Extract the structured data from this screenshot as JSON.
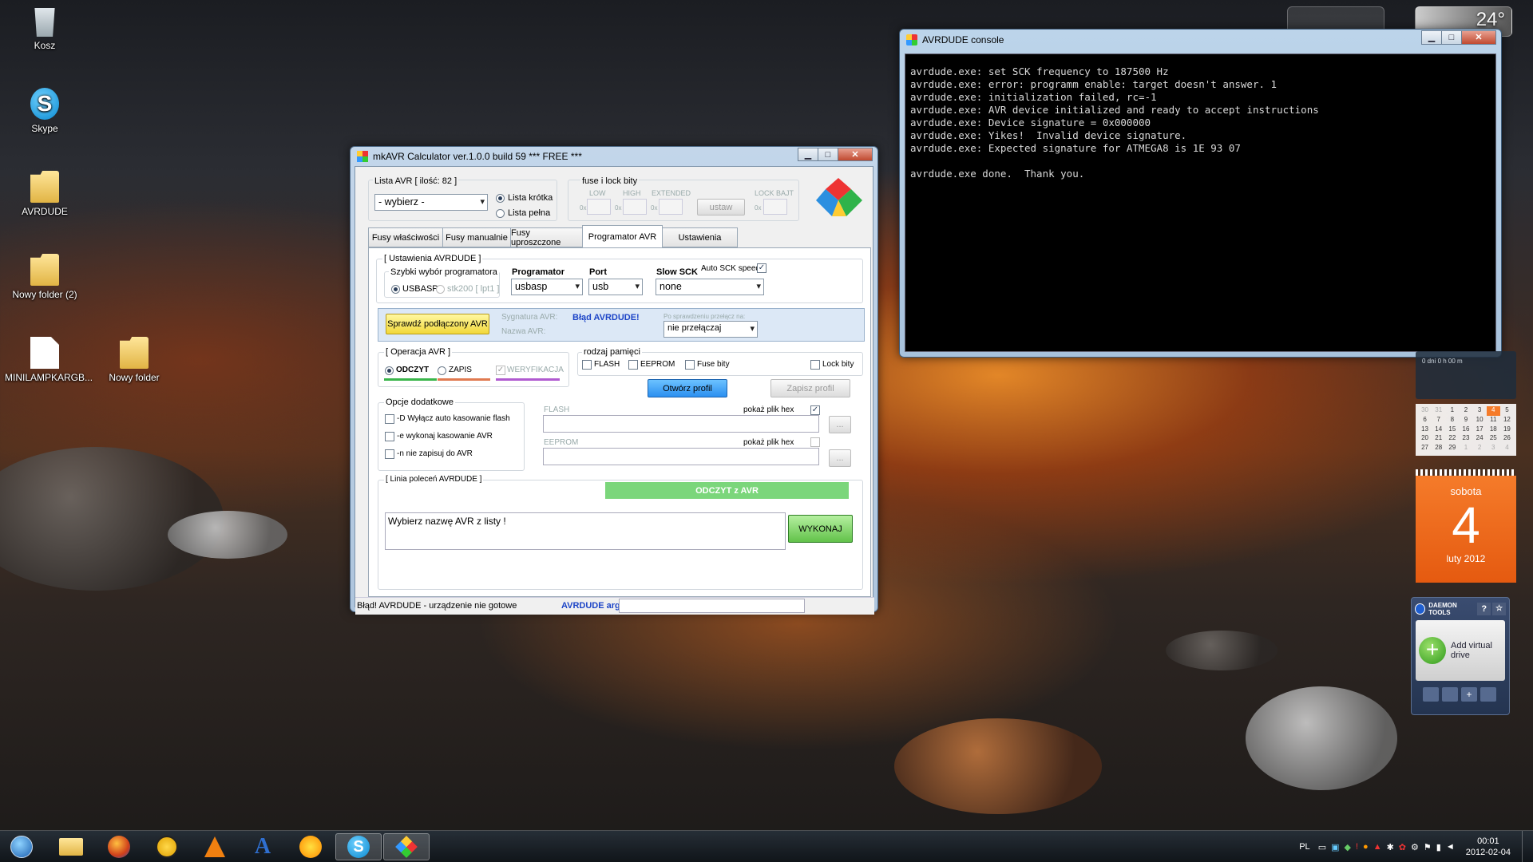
{
  "desktop": {
    "icons": [
      {
        "label": "Kosz"
      },
      {
        "label": "Skype"
      },
      {
        "label": "AVRDUDE"
      },
      {
        "label": "Nowy folder (2)"
      },
      {
        "label": "MINILAMPKARGB..."
      },
      {
        "label": "Nowy folder"
      }
    ]
  },
  "console": {
    "title": "AVRDUDE console",
    "lines": [
      "avrdude.exe: set SCK frequency to 187500 Hz",
      "avrdude.exe: error: programm enable: target doesn't answer. 1",
      "avrdude.exe: initialization failed, rc=-1",
      "avrdude.exe: AVR device initialized and ready to accept instructions",
      "avrdude.exe: Device signature = 0x000000",
      "avrdude.exe: Yikes!  Invalid device signature.",
      "avrdude.exe: Expected signature for ATMEGA8 is 1E 93 07",
      "",
      "avrdude.exe done.  Thank you."
    ]
  },
  "mkavr": {
    "title": "mkAVR Calculator ver.1.0.0 build 59   *** FREE ***",
    "lista_label": "Lista AVR [ ilość: 82 ]",
    "wybierz": "- wybierz -",
    "lista_krotka": "Lista krótka",
    "lista_pelna": "Lista pełna",
    "fuse_group": "fuse i lock bity",
    "low": "LOW",
    "high": "HIGH",
    "extended": "EXTENDED",
    "lock_bajt": "LOCK BAJT",
    "ox": "0x",
    "ustaw": "ustaw",
    "tabs": [
      "Fusy właściwości",
      "Fusy manualnie",
      "Fusy uproszczone",
      "Programator AVR",
      "Ustawienia"
    ],
    "ustawienia_avrdude": "[ Ustawienia AVRDUDE ]",
    "szybki_wybor": "Szybki wybór programatora",
    "usbasp_radio": "USBASP",
    "stk200_radio": "stk200 [ lpt1 ]",
    "programator_label": "Programator",
    "programator_value": "usbasp",
    "port_label": "Port",
    "port_value": "usb",
    "slow_sck_label": "Slow SCK",
    "slow_sck_value": "none",
    "auto_sck": "Auto SCK speed",
    "sprawdz_btn": "Sprawdź podłączony AVR",
    "sygnatura_label": "Sygnatura AVR:",
    "nazwa_label": "Nazwa AVR:",
    "blad": "Błąd AVRDUDE!",
    "po_sprawdzeniu": "Po sprawdzeniu przełącz na:",
    "nie_przelaczaj": "nie przełączaj",
    "operacja": "[ Operacja AVR ]",
    "odczyt": "ODCZYT",
    "zapis": "ZAPIS",
    "weryfikacja": "WERYFIKACJA",
    "rodzaj_pamieci": "rodzaj pamięci",
    "flash": "FLASH",
    "eeprom": "EEPROM",
    "fuse_bity": "Fuse bity",
    "lock_bity": "Lock bity",
    "otworz_profil": "Otwórz profil",
    "zapisz_profil": "Zapisz profil",
    "opcje": "Opcje dodatkowe",
    "opt_d": "-D Wyłącz auto kasowanie flash",
    "opt_e": "-e wykonaj kasowanie AVR",
    "opt_n": "-n nie zapisuj do AVR",
    "flash_label": "FLASH",
    "eeprom_label": "EEPROM",
    "pokaz_hex": "pokaż plik hex",
    "dots": "...",
    "linia": "[ Linia poleceń AVRDUDE ]",
    "odczyt_z_avr": "ODCZYT z AVR",
    "cmd_text": "Wybierz nazwę AVR z listy !",
    "wykonaj": "WYKONAJ",
    "status": "Błąd! AVRDUDE - urządzenie nie gotowe",
    "avrdude_arg": "AVRDUDE arg."
  },
  "gadgets": {
    "temp": "24°",
    "clock_fragment": "0 dni 0 h 00 m",
    "cal_rows": [
      [
        "30",
        "31",
        "1",
        "2",
        "3",
        "4",
        "5"
      ],
      [
        "6",
        "7",
        "8",
        "9",
        "10",
        "11",
        "12"
      ],
      [
        "13",
        "14",
        "15",
        "16",
        "17",
        "18",
        "19"
      ],
      [
        "20",
        "21",
        "22",
        "23",
        "24",
        "25",
        "26"
      ],
      [
        "27",
        "28",
        "29",
        "1",
        "2",
        "3",
        "4"
      ]
    ],
    "day_name": "sobota",
    "day_num": "4",
    "month_year": "luty 2012",
    "daemon_title": "DAEMON TOOLS",
    "daemon_help": "?",
    "add_virtual_drive": "Add virtual drive"
  },
  "taskbar": {
    "lang": "PL",
    "time": "00:01",
    "date": "2012-02-04"
  }
}
